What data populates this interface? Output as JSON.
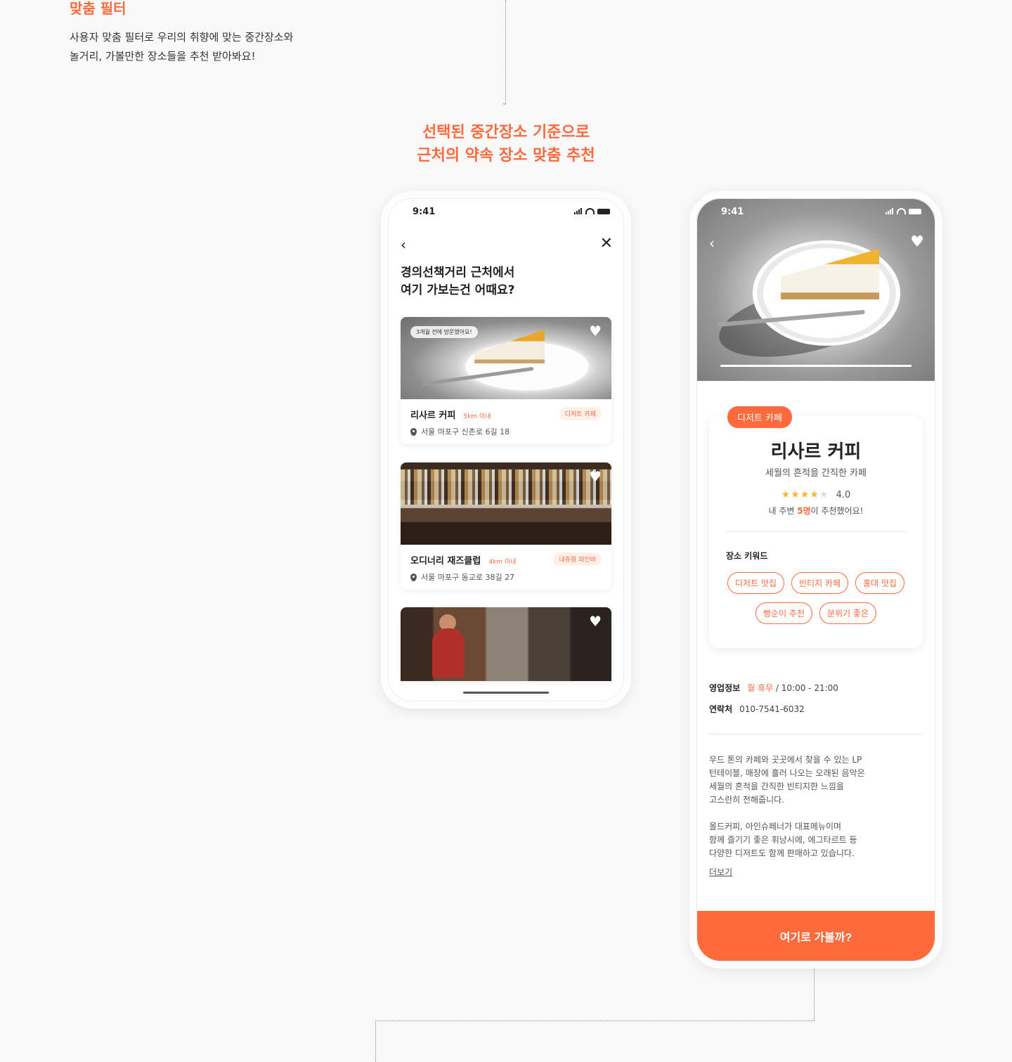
{
  "intro": {
    "title": "맞춤 필터",
    "desc_line1": "사용자 맞춤 필터로 우리의 취향에 맞는 중간장소와",
    "desc_line2": "놀거리, 가볼만한 장소들을 추천 받아봐요!"
  },
  "section": {
    "heading_line1": "선택된 중간장소 기준으로",
    "heading_line2": "근처의 약속 장소 맞춤 추천"
  },
  "phone1": {
    "status_time": "9:41",
    "title_line1": "경의선책거리 근처에서",
    "title_line2": "여기 가보는건 어때요?",
    "places": [
      {
        "name": "리사르 커피",
        "distance": "5km 이내",
        "tag": "디저트 카페",
        "address": "서울 마포구 신촌로 6길 18",
        "badge": "3개월 전에 방문했어요!"
      },
      {
        "name": "오디너리 재즈클럽",
        "distance": "4km 이내",
        "tag": "내츄럴 와인바",
        "address": "서울 마포구 동교로 38길 27"
      }
    ]
  },
  "phone2": {
    "status_time": "9:41",
    "photo_progress": 1.0,
    "category": "디저트 카페",
    "name": "리사르 커피",
    "subtitle": "세월의 흔적을 간직한 카페",
    "rating": "4.0",
    "rating_stars": 4,
    "recommend_prefix": "내 주변 ",
    "recommend_count": "5명",
    "recommend_suffix": "이 추천했어요!",
    "keywords_title": "장소 키워드",
    "keywords_row1": [
      "디저트 맛집",
      "빈티지 카페",
      "홍대 맛집"
    ],
    "keywords_row2": [
      "빵순이 추천",
      "분위기 좋은"
    ],
    "hours_label": "영업정보",
    "hours_closed": "월 휴무",
    "hours_time": " / 10:00 - 21:00",
    "contact_label": "연락처",
    "contact_value": "010-7541-6032",
    "desc_lines": [
      "우드 톤의 카페와 곳곳에서 찾을 수 있는 LP",
      "턴테이블, 매장에 흘러 나오는 오래된 음악은",
      "세월의 흔적을 간직한 빈티지한 느낌을",
      "고스란히 전해줍니다.",
      "",
      "올드커피, 아인슈페너가 대표메뉴이며",
      "함께 즐기기 좋은 휘낭시에, 에그타르트 등",
      "다양한 디저트도 함께 판매하고 있습니다."
    ],
    "more": "더보기",
    "cta": "여기로 가볼까?"
  },
  "colors": {
    "accent": "#ff6a3d",
    "star": "#f5b82e"
  }
}
